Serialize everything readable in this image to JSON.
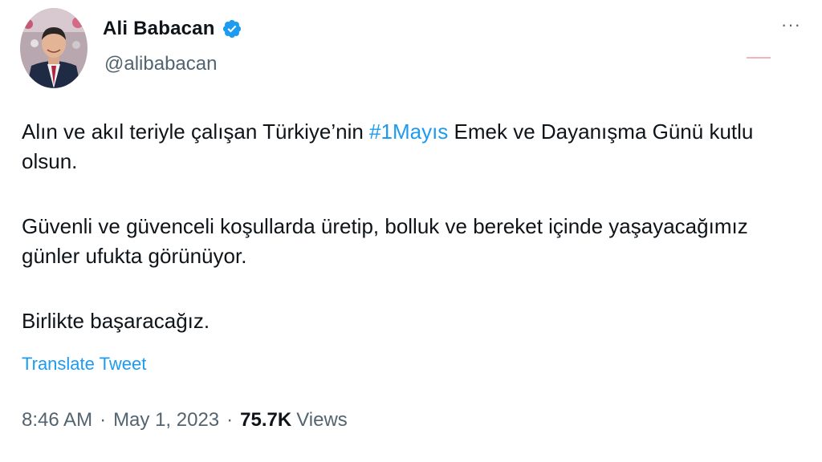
{
  "author": {
    "display_name": "Ali Babacan",
    "handle": "@alibabacan",
    "verified_icon": "verified-badge-icon",
    "avatar": "profile-photo"
  },
  "header": {
    "more_icon": "more-options-icon",
    "more_label": "···"
  },
  "tweet": {
    "p1_before": "Alın ve akıl teriyle çalışan Türkiye’nin ",
    "hashtag": "#1Mayıs",
    "p1_after": " Emek ve Dayanışma Günü kutlu olsun.",
    "p2": "Güvenli ve güvenceli koşullarda üretip, bolluk ve bereket içinde yaşayacağımız günler ufukta görünüyor.",
    "p3": "Birlikte başaracağız."
  },
  "translate_label": "Translate Tweet",
  "meta": {
    "time": "8:46 AM",
    "separator": "·",
    "date": "May 1, 2023",
    "views_count": "75.7K",
    "views_label": "Views"
  },
  "colors": {
    "link": "#1d9bf0",
    "text": "#0f1419",
    "secondary": "#536471"
  }
}
